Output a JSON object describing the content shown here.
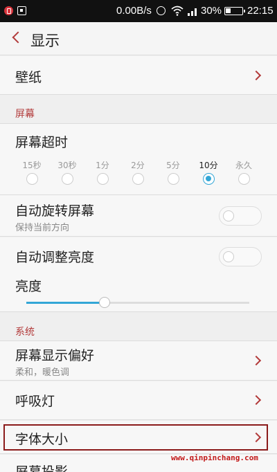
{
  "status_bar": {
    "speed": "0.00B/s",
    "battery": "30%",
    "time": "22:15"
  },
  "header": {
    "title": "显示"
  },
  "wallpaper": {
    "label": "壁纸"
  },
  "section_screen": {
    "title": "屏幕"
  },
  "screen_timeout": {
    "label": "屏幕超时",
    "options": [
      "15秒",
      "30秒",
      "1分",
      "2分",
      "5分",
      "10分",
      "永久"
    ],
    "selected": "10分"
  },
  "auto_rotate": {
    "label": "自动旋转屏幕",
    "sublabel": "保持当前方向",
    "enabled": false
  },
  "auto_brightness": {
    "label": "自动调整亮度",
    "enabled": false
  },
  "brightness": {
    "label": "亮度",
    "level": 0.35,
    "accent": "#33a6d6"
  },
  "section_system": {
    "title": "系统"
  },
  "display_pref": {
    "label": "屏幕显示偏好",
    "sublabel": "柔和，暖色调"
  },
  "breathing_light": {
    "label": "呼吸灯"
  },
  "font_size": {
    "label": "字体大小"
  },
  "screen_projection": {
    "label": "屏幕投影"
  },
  "watermark": {
    "text": "www.qinpinchang.com"
  },
  "colors": {
    "accent_red": "#b23a3a",
    "accent_blue": "#33a6d6",
    "highlight_border": "#8b1a1a"
  }
}
